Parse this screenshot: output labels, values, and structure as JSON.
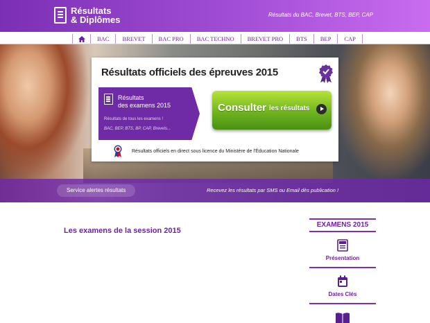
{
  "header": {
    "logo_line1": "Résultats",
    "logo_line2": "& Diplômes",
    "tagline": "Résultats du BAC, Brevet, BTS, BEP, CAP"
  },
  "nav": {
    "items": [
      "BAC",
      "BREVET",
      "BAC PRO",
      "BAC TECHNO",
      "BREVET PRO",
      "BTS",
      "BEP",
      "CAP"
    ]
  },
  "hero": {
    "card_title": "Résultats officiels des épreuves 2015",
    "box_title_line1": "Résultats",
    "box_title_line2": "des examens 2015",
    "box_subtitle": "Résultats de tous les examens !",
    "box_list": "BAC, BEP, BTS, BP, CAP, Brevets...",
    "consult_big": "Consulter",
    "consult_small": "les résultats",
    "footer_text": "Résultats officiels en direct sous licence du Ministère de l'Éducation Nationale"
  },
  "alerts": {
    "button_label": "Service alertes résultats",
    "text": "Recevez les résultats par SMS ou Email dès publication !"
  },
  "main": {
    "section_title": "Les examens de la session 2015"
  },
  "sidebar": {
    "header": "EXAMENS 2015",
    "items": [
      {
        "label": "Présentation",
        "icon": "document-2015-icon"
      },
      {
        "label": "Dates Clés",
        "icon": "calendar-icon"
      },
      {
        "label": "",
        "icon": "book-icon"
      }
    ]
  },
  "colors": {
    "brand_purple": "#7b2fb5",
    "accent_green": "#6fb51e"
  }
}
